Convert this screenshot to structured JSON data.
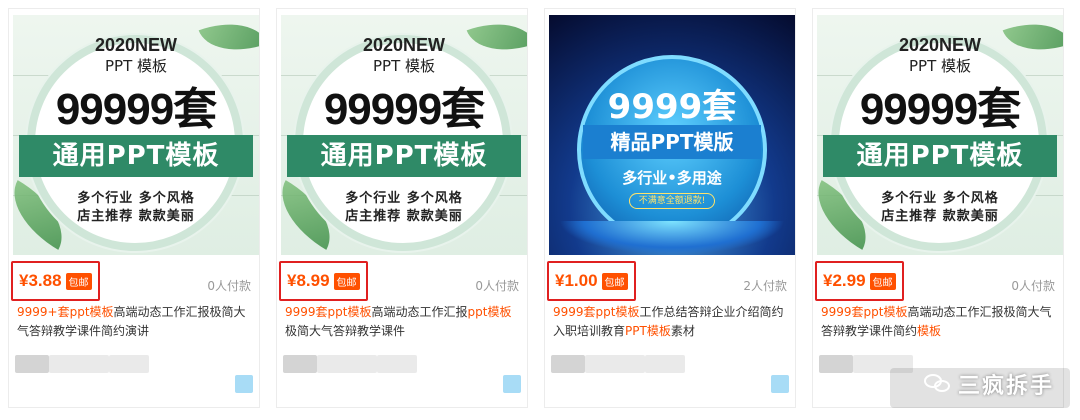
{
  "products": [
    {
      "thumb": {
        "year": "2020NEW",
        "sub": "PPT 模板",
        "big": "99999套",
        "ribbon": "通用PPT模板",
        "line1": "多个行业  多个风格",
        "line2": "店主推荐  款款美丽"
      },
      "price": "¥3.88",
      "free_shipping": "包邮",
      "paid_count": "0人付款",
      "desc_parts": [
        "9999+套ppt模板",
        "高端动态工作汇报极简大气答辩教学课件简约演讲"
      ]
    },
    {
      "thumb": {
        "year": "2020NEW",
        "sub": "PPT 模板",
        "big": "99999套",
        "ribbon": "通用PPT模板",
        "line1": "多个行业  多个风格",
        "line2": "店主推荐  款款美丽"
      },
      "price": "¥8.99",
      "free_shipping": "包邮",
      "paid_count": "0人付款",
      "desc_parts": [
        "9999套ppt模板",
        "高端动态工作汇报",
        "ppt模板",
        "极简大气答辩教学课件"
      ]
    },
    {
      "thumb": {
        "big": "9999套",
        "ribbon": "精品PPT模版",
        "line1": "多行业•多用途",
        "button": "不满意全额退款!"
      },
      "price": "¥1.00",
      "free_shipping": "包邮",
      "paid_count": "2人付款",
      "desc_parts": [
        "9999套ppt模板",
        "工作总结答辩企业介绍简约入职培训教育",
        "PPT模板",
        "素材"
      ]
    },
    {
      "thumb": {
        "year": "2020NEW",
        "sub": "PPT 模板",
        "big": "99999套",
        "ribbon": "通用PPT模板",
        "line1": "多个行业  多个风格",
        "line2": "店主推荐  款款美丽"
      },
      "price": "¥2.99",
      "free_shipping": "包邮",
      "paid_count": "0人付款",
      "desc_parts": [
        "9999套ppt模板",
        "高端动态工作汇报极简大气答辩教学课件简约",
        "模板"
      ]
    }
  ],
  "watermark": {
    "icon": "wechat-icon",
    "text": "三疯拆手"
  },
  "colors": {
    "price": "#ff5000",
    "highlight_box": "#e02020",
    "ribbon_green": "#2f8a67",
    "ribbon_blue": "#1b7fd0"
  }
}
